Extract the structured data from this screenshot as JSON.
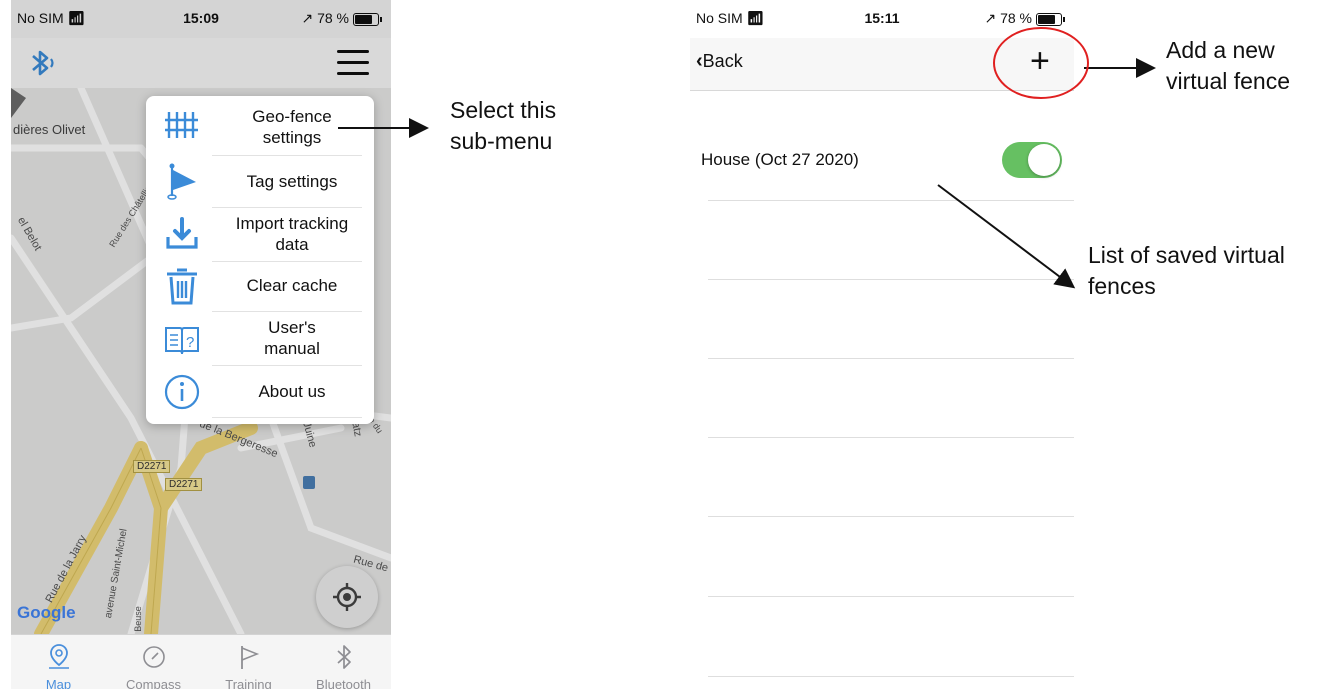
{
  "left_screen": {
    "status": {
      "carrier": "No SIM",
      "time": "15:09",
      "battery": "78 %"
    },
    "header": {
      "bluetooth_icon": "bluetooth-icon",
      "menu_icon": "hamburger-icon"
    },
    "map": {
      "labels": [
        "dières Olivet",
        "Rue des Châtelliers",
        "el Belot",
        "de la Bergeresse",
        "la Juine",
        "des Clatz",
        "Rue de la Jarry",
        "avenue Saint-Michel",
        "Rue de",
        "Beuse",
        "de du"
      ],
      "roads": [
        "D2271",
        "D2271"
      ],
      "attribution": "Google"
    },
    "menu": {
      "items": [
        {
          "label": "Geo-fence settings",
          "icon": "fence-icon"
        },
        {
          "label": "Tag settings",
          "icon": "flag-icon"
        },
        {
          "label": "Import tracking data",
          "icon": "download-icon"
        },
        {
          "label": "Clear cache",
          "icon": "trash-icon"
        },
        {
          "label": "User's manual",
          "icon": "manual-icon"
        },
        {
          "label": "About us",
          "icon": "info-icon"
        }
      ]
    },
    "tabs": [
      {
        "label": "Map",
        "icon": "map-pin-icon",
        "active": true
      },
      {
        "label": "Compass",
        "icon": "compass-icon",
        "active": false
      },
      {
        "label": "Training",
        "icon": "flag-outline-icon",
        "active": false
      },
      {
        "label": "Bluetooth",
        "icon": "bluetooth-icon",
        "active": false
      }
    ],
    "colors": {
      "accent": "#4a8fdc",
      "icon_blue": "#3b8bd8",
      "road_yellow": "#f0d77a"
    }
  },
  "right_screen": {
    "status": {
      "carrier": "No SIM",
      "time": "15:11",
      "battery": "78 %"
    },
    "nav": {
      "back_label": "Back",
      "add_label": "+"
    },
    "fences": [
      {
        "name": "House  (Oct 27 2020)",
        "enabled": true
      }
    ],
    "colors": {
      "toggle_on": "#66c062",
      "highlight_circle": "#e02020"
    }
  },
  "annotations": {
    "select_submenu": "Select this\nsub-menu",
    "add_fence": "Add a new\nvirtual fence",
    "saved_list": "List of saved virtual\nfences"
  }
}
